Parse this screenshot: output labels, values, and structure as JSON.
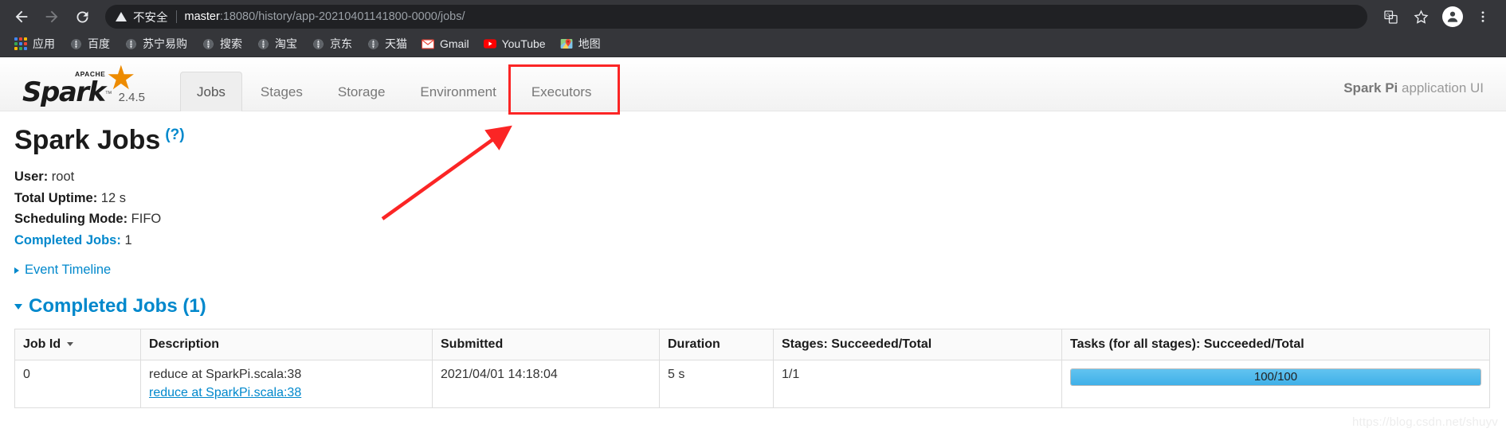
{
  "browser": {
    "nav": {
      "back_label": "Back",
      "forward_label": "Forward",
      "reload_label": "Reload"
    },
    "omnibox": {
      "security_label": "不安全",
      "url_host": "master",
      "url_path": ":18080/history/app-20210401141800-0000/jobs/"
    },
    "toolbar_right": {
      "translate_label": "Translate",
      "bookmark_label": "Bookmark this tab",
      "profile_label": "Profile",
      "menu_label": "Customize and control"
    },
    "bookmarks": [
      {
        "label": "应用",
        "icon": "apps-grid-icon"
      },
      {
        "label": "百度",
        "icon": "globe-icon"
      },
      {
        "label": "苏宁易购",
        "icon": "globe-icon"
      },
      {
        "label": "搜索",
        "icon": "globe-icon"
      },
      {
        "label": "淘宝",
        "icon": "globe-icon"
      },
      {
        "label": "京东",
        "icon": "globe-icon"
      },
      {
        "label": "天猫",
        "icon": "globe-icon"
      },
      {
        "label": "Gmail",
        "icon": "gmail-icon"
      },
      {
        "label": "YouTube",
        "icon": "youtube-icon"
      },
      {
        "label": "地图",
        "icon": "maps-icon"
      }
    ]
  },
  "spark": {
    "brand": {
      "apache_label": "APACHE",
      "name": "Spark",
      "trademark": "™",
      "version": "2.4.5"
    },
    "tabs": [
      {
        "label": "Jobs",
        "active": true,
        "highlighted": false
      },
      {
        "label": "Stages",
        "active": false,
        "highlighted": false
      },
      {
        "label": "Storage",
        "active": false,
        "highlighted": false
      },
      {
        "label": "Environment",
        "active": false,
        "highlighted": false
      },
      {
        "label": "Executors",
        "active": false,
        "highlighted": true
      }
    ],
    "app_ui_bold": "Spark Pi",
    "app_ui_rest": " application UI",
    "page_title": "Spark Jobs",
    "help_marker": "(?)",
    "summary": [
      {
        "label": "User:",
        "value": " root",
        "link": false
      },
      {
        "label": "Total Uptime:",
        "value": " 12 s",
        "link": false
      },
      {
        "label": "Scheduling Mode:",
        "value": " FIFO",
        "link": false
      },
      {
        "label": "Completed Jobs:",
        "value": " 1",
        "link": true
      }
    ],
    "event_timeline_label": "Event Timeline",
    "completed_section_label": "Completed Jobs (1)",
    "table": {
      "headers": [
        "Job Id",
        "Description",
        "Submitted",
        "Duration",
        "Stages: Succeeded/Total",
        "Tasks (for all stages): Succeeded/Total"
      ],
      "rows": [
        {
          "job_id": "0",
          "description_main": "reduce at SparkPi.scala:38",
          "description_link": "reduce at SparkPi.scala:38",
          "submitted": "2021/04/01 14:18:04",
          "duration": "5 s",
          "stages": "1/1",
          "tasks_text": "100/100",
          "tasks_percent": 100
        }
      ]
    },
    "accent_color": "#0088cc",
    "progress_color": "#45b3ea",
    "highlight_color": "#fb2525"
  },
  "watermark": "https://blog.csdn.net/shuyv"
}
